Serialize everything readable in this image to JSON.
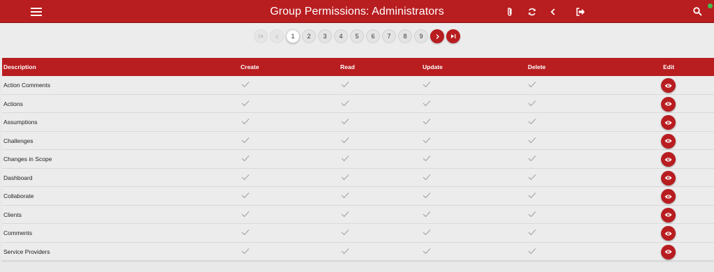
{
  "header": {
    "title": "Group Permissions: Administrators",
    "icons": [
      "menu-icon",
      "attachment-icon",
      "refresh-icon",
      "back-icon",
      "logout-icon",
      "search-icon"
    ],
    "bg_color": "#b81d20"
  },
  "pagination": {
    "pages": [
      "1",
      "2",
      "3",
      "4",
      "5",
      "6",
      "7",
      "8",
      "9"
    ],
    "current": "1",
    "first_label": "⏮",
    "prev_label": "‹",
    "next_label": "›",
    "last_label": "⏭"
  },
  "table": {
    "headers": {
      "description": "Description",
      "create": "Create",
      "read": "Read",
      "update": "Update",
      "delete": "Delete",
      "edit": "Edit"
    },
    "rows": [
      {
        "description": "Action Comments",
        "create": true,
        "read": true,
        "update": true,
        "delete": true
      },
      {
        "description": "Actions",
        "create": true,
        "read": true,
        "update": true,
        "delete": true
      },
      {
        "description": "Assumptions",
        "create": true,
        "read": true,
        "update": true,
        "delete": true
      },
      {
        "description": "Challenges",
        "create": true,
        "read": true,
        "update": true,
        "delete": true
      },
      {
        "description": "Changes in Scope",
        "create": true,
        "read": true,
        "update": true,
        "delete": true
      },
      {
        "description": "Dashboard",
        "create": true,
        "read": true,
        "update": true,
        "delete": true
      },
      {
        "description": "Collaborate",
        "create": true,
        "read": true,
        "update": true,
        "delete": true
      },
      {
        "description": "Clients",
        "create": true,
        "read": true,
        "update": true,
        "delete": true
      },
      {
        "description": "Comments",
        "create": true,
        "read": true,
        "update": true,
        "delete": true
      },
      {
        "description": "Service Providers",
        "create": true,
        "read": true,
        "update": true,
        "delete": true
      }
    ]
  },
  "colors": {
    "accent": "#b81d20",
    "status_online": "#3fbf4f",
    "check": "#9e9e9e"
  }
}
